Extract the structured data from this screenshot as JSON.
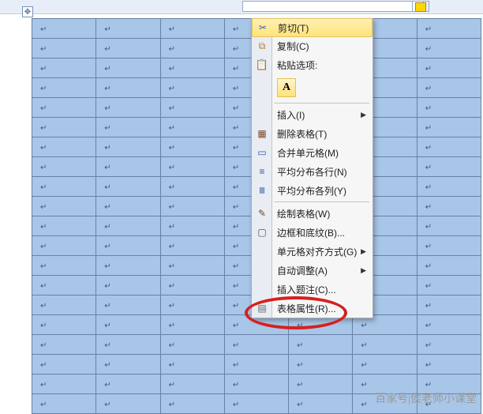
{
  "toolbar": {},
  "table": {
    "rows": 20,
    "cols": 7
  },
  "context_menu": {
    "items": [
      {
        "type": "item",
        "label": "剪切(T)",
        "icon": "ic-cut",
        "selected": true
      },
      {
        "type": "item",
        "label": "复制(C)",
        "icon": "ic-copy"
      },
      {
        "type": "item",
        "label": "粘贴选项:",
        "icon": "ic-paste"
      },
      {
        "type": "paste-btn",
        "label": "A"
      },
      {
        "type": "sep"
      },
      {
        "type": "item",
        "label": "插入(I)",
        "arrow": true
      },
      {
        "type": "item",
        "label": "删除表格(T)",
        "icon": "ic-del"
      },
      {
        "type": "item",
        "label": "合并单元格(M)",
        "icon": "ic-merge"
      },
      {
        "type": "item",
        "label": "平均分布各行(N)",
        "icon": "ic-rows"
      },
      {
        "type": "item",
        "label": "平均分布各列(Y)",
        "icon": "ic-cols"
      },
      {
        "type": "sep"
      },
      {
        "type": "item",
        "label": "绘制表格(W)",
        "icon": "ic-draw"
      },
      {
        "type": "item",
        "label": "边框和底纹(B)...",
        "icon": "ic-border"
      },
      {
        "type": "item",
        "label": "单元格对齐方式(G)",
        "arrow": true
      },
      {
        "type": "item",
        "label": "自动调整(A)",
        "arrow": true
      },
      {
        "type": "item",
        "label": "插入题注(C)..."
      },
      {
        "type": "item",
        "label": "表格属性(R)...",
        "icon": "ic-prop"
      }
    ]
  },
  "watermark": "百家号|侯老师小课堂"
}
